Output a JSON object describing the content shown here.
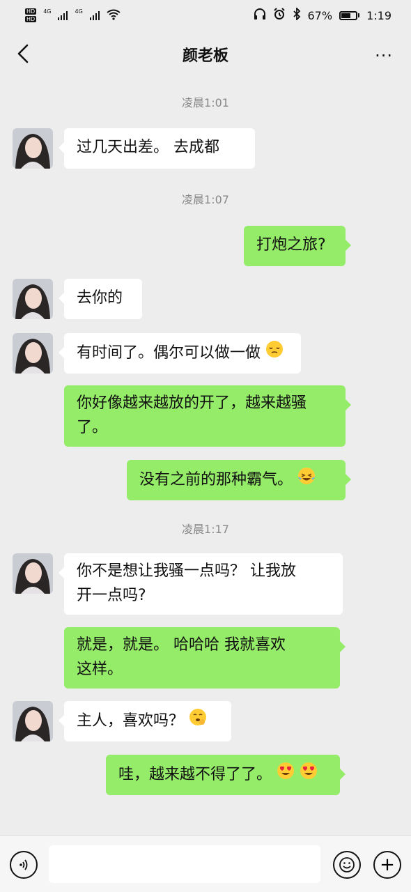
{
  "status_bar": {
    "left_labels": [
      "HD",
      "HD",
      "4G",
      "4G"
    ],
    "battery": "67%",
    "battery_level": 0.67,
    "time": "1:19"
  },
  "header": {
    "title": "颜老板",
    "back_icon": "chevron-left-icon",
    "more_icon": "more-dots-icon",
    "more": "···"
  },
  "messages": {
    "ts1": "凌晨1:01",
    "m1": "过几天出差。 去成都",
    "ts2": "凌晨1:07",
    "m2": "打炮之旅?",
    "m3": "去你的",
    "m4": "有时间了。偶尔可以做一做",
    "m5a": "你好像越来越放的开了，越来越骚",
    "m5b": "了。",
    "m6": "没有之前的那种霸气。",
    "ts3": "凌晨1:17",
    "m7a": "你不是想让我骚一点吗？  让我放",
    "m7b": "开一点吗?",
    "m8a": "就是，就是。   哈哈哈   我就喜欢",
    "m8b": "这样。",
    "m9": "主人，喜欢吗？",
    "m10": "哇，越来越不得了了。"
  },
  "colors": {
    "background": "#ededed",
    "incoming_bubble": "#ffffff",
    "outgoing_bubble": "#95ec69"
  },
  "input_bar": {
    "voice_icon": "voice-icon",
    "emoji_icon": "emoji-icon",
    "plus_icon": "plus-icon",
    "plus": "+"
  }
}
